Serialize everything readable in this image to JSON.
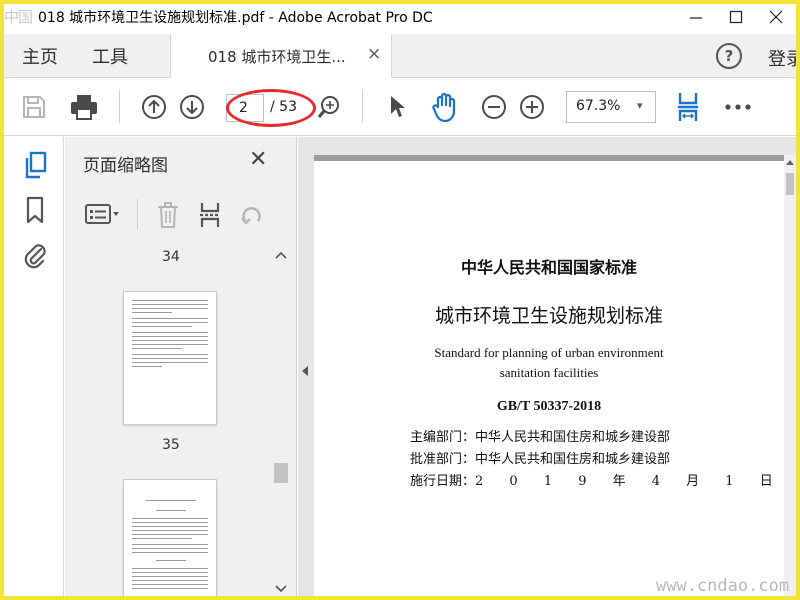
{
  "window": {
    "logo_text": "中国",
    "title": "018 城市环境卫生设施规划标准.pdf - Adobe Acrobat Pro DC"
  },
  "tabs": {
    "home": "主页",
    "tools": "工具",
    "document": "018 城市环境卫生...",
    "close_glyph": "×",
    "help_glyph": "?",
    "login": "登录"
  },
  "toolbar": {
    "current_page": "2",
    "page_total": "/ 53",
    "zoom": "67.3%",
    "zoom_caret": "▾"
  },
  "panel": {
    "title": "页面缩略图",
    "close_glyph": "✕",
    "thumbnails": [
      {
        "page": "34"
      },
      {
        "page": "35"
      }
    ]
  },
  "document": {
    "heading_cn": "中华人民共和国国家标准",
    "title_cn": "城市环境卫生设施规划标准",
    "title_en_line1": "Standard for planning of urban environment",
    "title_en_line2": "sanitation facilities",
    "code": "GB/T 50337-2018",
    "chief_editor": "主编部门：中华人民共和国住房和城乡建设部",
    "approver": "批准部门：中华人民共和国住房和城乡建设部",
    "date_label": "施行日期：",
    "date_value": "2 0 1 9 年 4 月 1 日"
  },
  "watermark": "www.cndao.com",
  "colors": {
    "frame": "#f1e33a",
    "accent_blue": "#1a73c7",
    "annotation_red": "#e52a2a"
  }
}
